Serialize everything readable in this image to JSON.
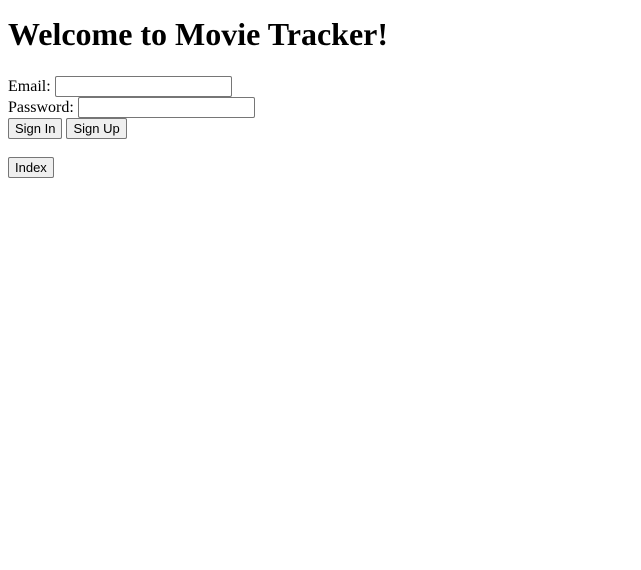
{
  "header": {
    "title": "Welcome to Movie Tracker!"
  },
  "login_form": {
    "email_label": "Email:",
    "email_value": "",
    "password_label": "Password:",
    "password_value": "",
    "sign_in_label": "Sign In",
    "sign_up_label": "Sign Up"
  },
  "nav": {
    "index_label": "Index"
  }
}
